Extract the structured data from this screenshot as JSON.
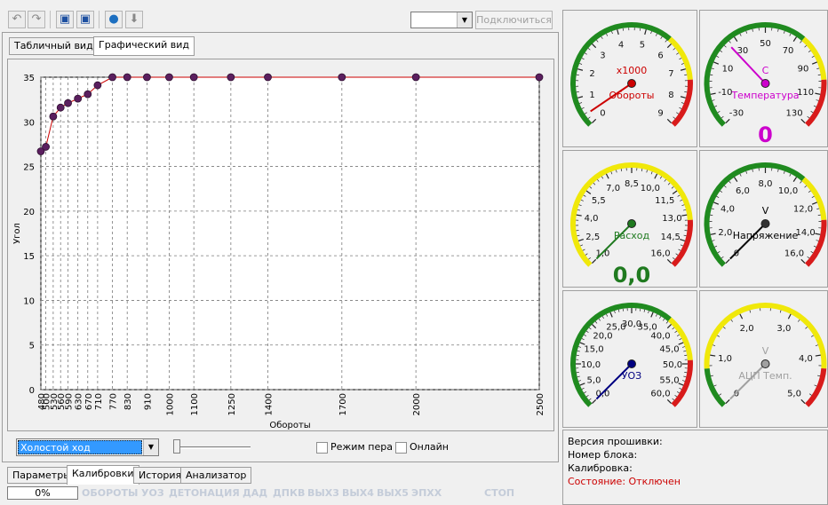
{
  "toolbar": {
    "icons": [
      "arrow-left-icon",
      "arrow-right-icon",
      "save-icon",
      "save-as-icon",
      "globe-icon",
      "download-icon"
    ],
    "port_value": "",
    "connect_label": "Подключиться"
  },
  "view_tabs": [
    "Табличный вид",
    "Графический вид"
  ],
  "chart_data": {
    "type": "line",
    "ylabel": "Угол",
    "xlabel": "Обороты",
    "x": [
      480,
      500,
      530,
      560,
      590,
      630,
      670,
      710,
      770,
      830,
      910,
      1000,
      1100,
      1250,
      1400,
      1700,
      2000,
      2500
    ],
    "x_tick_labels": [
      "480",
      "500",
      "530",
      "560",
      "590",
      "630",
      "670",
      "710",
      "770",
      "830",
      "910",
      "1000",
      "1100",
      "1250",
      "1400",
      "1700",
      "2000",
      "2500"
    ],
    "values": [
      26.7,
      27.2,
      30.6,
      31.6,
      32.1,
      32.6,
      33.1,
      34.1,
      35,
      35,
      35,
      35,
      35,
      35,
      35,
      35,
      35,
      35
    ],
    "ylim": [
      0,
      35
    ],
    "y_ticks": [
      "0",
      "5",
      "10",
      "15",
      "20",
      "25",
      "30",
      "35"
    ],
    "grid": true,
    "line_color": "#cc0000",
    "point_color": "#5b1f5f"
  },
  "controls": {
    "mode_value": "Холостой ход",
    "pen_mode_label": "Режим пера",
    "online_label": "Онлайн"
  },
  "bottom_tabs": [
    "Параметры",
    "Калибровки",
    "История",
    "Анализатор"
  ],
  "active_bottom_tab": "Калибровки",
  "status": {
    "progress_text": "0%",
    "progress": 0,
    "indicators": [
      "ОБОРОТЫ",
      "УОЗ",
      "ДЕТОНАЦИЯ",
      "ДАД",
      "ДПКВ",
      "ВЫХ3",
      "ВЫХ4",
      "ВЫХ5",
      "ЭПХХ",
      "СТОП"
    ]
  },
  "gauges": [
    {
      "name": "rpm",
      "ticks": [
        "0",
        "1",
        "2",
        "3",
        "4",
        "5",
        "6",
        "7",
        "8",
        "9"
      ],
      "unit": "x1000",
      "label": "Обороты",
      "readout": "",
      "color": "#cc0000",
      "needle_fraction": 0.04
    },
    {
      "name": "temperature",
      "ticks": [
        "-30",
        "-10",
        "10",
        "30",
        "50",
        "70",
        "90",
        "110",
        "130"
      ],
      "unit": "C",
      "label": "Температура",
      "readout": "0",
      "color": "#cc00cc",
      "needle_fraction": 0.34
    },
    {
      "name": "consumption",
      "ticks": [
        "1,0",
        "2,5",
        "4,0",
        "5,5",
        "7,0",
        "8,5",
        "10,0",
        "11,5",
        "13,0",
        "14,5",
        "16,0"
      ],
      "unit": "",
      "label": "Расход",
      "readout": "0,0",
      "color": "#1f7a1f",
      "needle_fraction": 0.0
    },
    {
      "name": "voltage",
      "ticks": [
        "0",
        "2,0",
        "4,0",
        "6,0",
        "8,0",
        "10,0",
        "12,0",
        "14,0",
        "16,0"
      ],
      "unit": "V",
      "label": "Напряжение",
      "readout": "",
      "color": "#000000",
      "needle_fraction": 0.0
    },
    {
      "name": "advance",
      "ticks": [
        "0,0",
        "5,0",
        "10,0",
        "15,0",
        "20,0",
        "25,0",
        "30,0",
        "35,0",
        "40,0",
        "45,0",
        "50,0",
        "55,0",
        "60,0"
      ],
      "unit": "",
      "label": "УОЗ",
      "readout": "",
      "color": "#000080",
      "needle_fraction": 0.0
    },
    {
      "name": "adc-temp",
      "ticks": [
        "0",
        "1,0",
        "2,0",
        "3,0",
        "4,0",
        "5,0"
      ],
      "unit": "V",
      "label": "АЦП Темп.",
      "readout": "",
      "color": "#a0a0a0",
      "needle_fraction": 0.0
    }
  ],
  "info": {
    "firmware_label": "Версия прошивки:",
    "block_label": "Номер блока:",
    "calibration_label": "Калибровка:",
    "state_label": "Состояние: Отключен",
    "state_color": "#cc0000"
  }
}
